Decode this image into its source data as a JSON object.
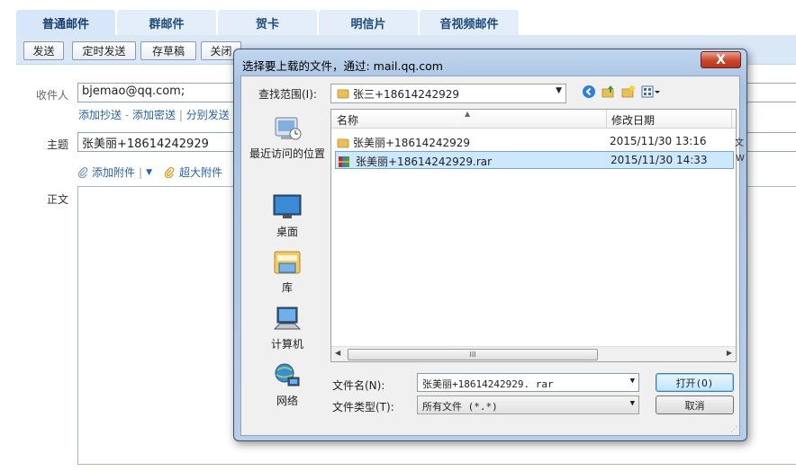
{
  "tabs": [
    "普通邮件",
    "群邮件",
    "贺卡",
    "明信片",
    "音视频邮件"
  ],
  "toolbar": {
    "send": "发送",
    "schedule": "定时发送",
    "draft": "存草稿",
    "close": "关闭"
  },
  "compose": {
    "to_label": "收件人",
    "to_value": "bjemao@qq.com;",
    "cc_links": [
      "添加抄送",
      "添加密送",
      "分别发送"
    ],
    "cc_sep1": "-",
    "cc_sep2": "|",
    "subject_label": "主题",
    "subject_value": "张美丽+18614242929",
    "attach_label": "添加附件",
    "attach_sep": "|",
    "attach_more": "▼",
    "big_attach_label": "超大附件",
    "body_label": "正文"
  },
  "dialog": {
    "title": "选择要上载的文件，通过: mail.qq.com",
    "close_glyph": "X",
    "lookin_label": "查找范围(I):",
    "lookin_value": "张三+18614242929",
    "places": [
      "最近访问的位置",
      "桌面",
      "库",
      "计算机",
      "网络"
    ],
    "columns": {
      "name": "名称",
      "date": "修改日期"
    },
    "files": [
      {
        "name": "张美丽+18614242929",
        "date": "2015/11/30 13:16",
        "icon": "folder-icon",
        "extra": "文"
      },
      {
        "name": "张美丽+18614242929.rar",
        "date": "2015/11/30 14:33",
        "icon": "rar-icon",
        "extra": "W"
      }
    ],
    "scroll_grip": "III",
    "filename_label": "文件名(N):",
    "filename_value": "张美丽+18614242929. rar",
    "filetype_label": "文件类型(T):",
    "filetype_value": "所有文件 (*.*)",
    "open_button": "打开(O)",
    "cancel_button": "取消"
  }
}
